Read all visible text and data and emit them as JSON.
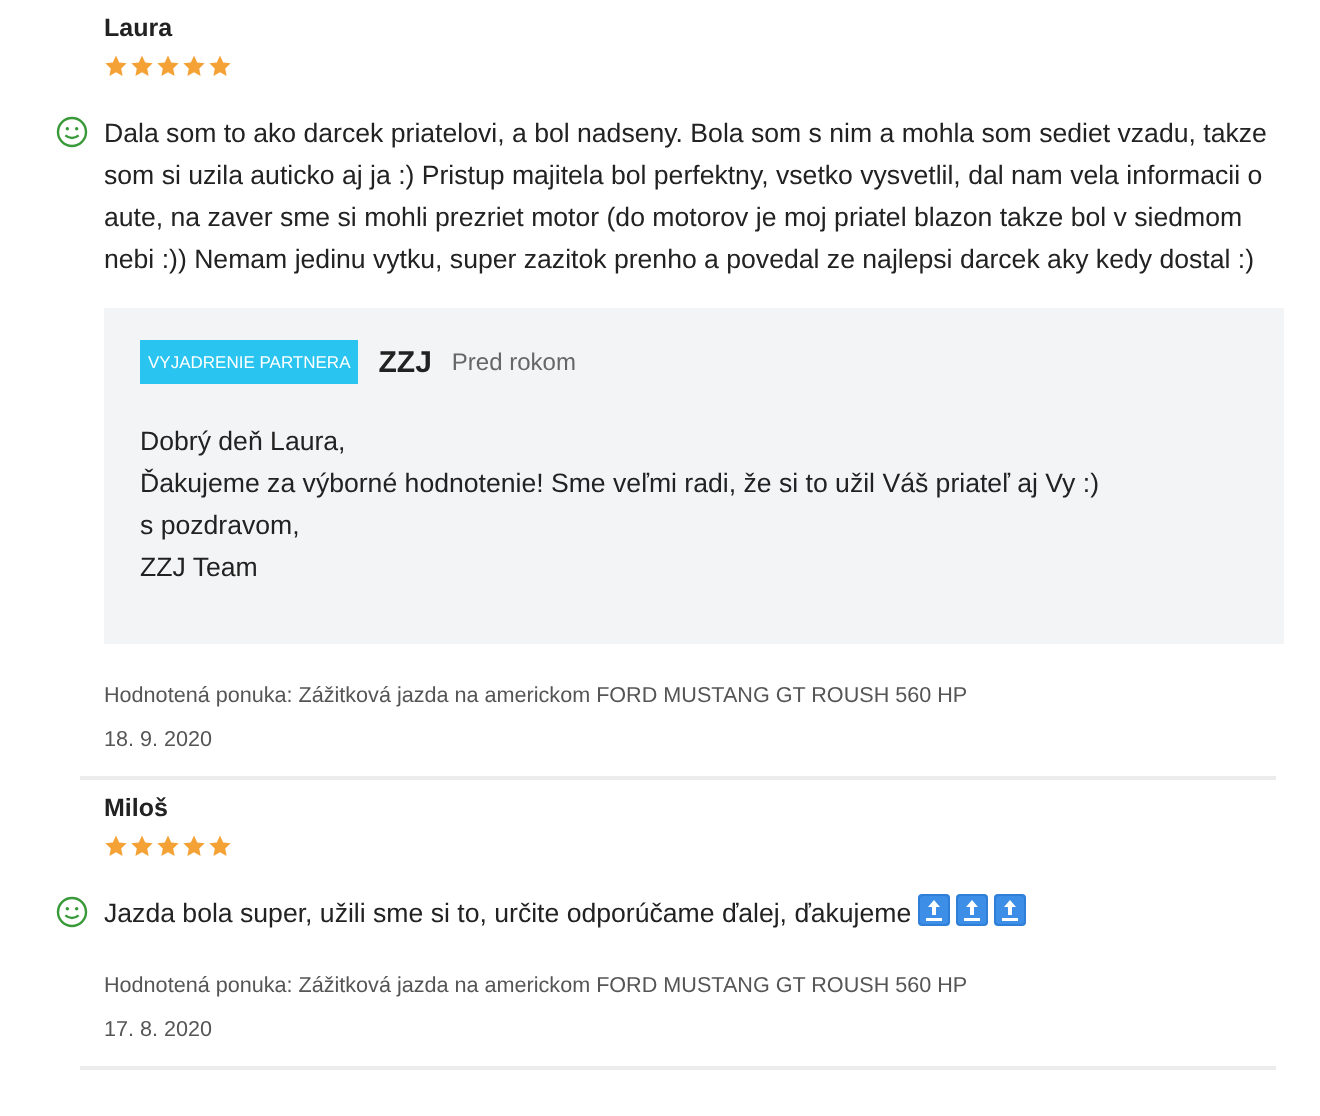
{
  "reviews": [
    {
      "author": "Laura",
      "stars": 5,
      "kind": "positive",
      "text": "Dala som to ako darcek priatelovi, a bol nadseny. Bola som s nim a mohla som sediet vzadu, takze som si uzila auticko aj ja :) Pristup majitela bol perfektny, vsetko vysvetlil, dal nam vela informacii o aute, na zaver sme si mohli prezriet motor (do motorov je moj priatel blazon takze bol v siedmom nebi :)) Nemam jedinu vytku, super zazitok prenho a povedal ze najlepsi darcek aky kedy dostal :)",
      "reply": {
        "badge": "VYJADRENIE PARTNERA",
        "partner": "ZZJ",
        "time": "Pred rokom",
        "lines": [
          "Dobrý deň Laura,",
          "Ďakujeme za výborné hodnotenie! Sme veľmi radi, že si to užil Váš priateľ aj Vy :)",
          "s pozdravom,",
          "ZZJ Team"
        ]
      },
      "offer": "Hodnotená ponuka: Zážitková jazda na americkom FORD MUSTANG GT ROUSH 560 HP",
      "date": "18. 9. 2020"
    },
    {
      "author": "Miloš",
      "stars": 5,
      "kind": "positive",
      "text": "Jazda bola super, užili sme si to, určite odporúčame ďalej, ďakujeme",
      "trailing_icons": [
        {
          "kind": "top"
        },
        {
          "kind": "top"
        },
        {
          "kind": "top"
        }
      ],
      "offer": "Hodnotená ponuka: Zážitková jazda na americkom FORD MUSTANG GT ROUSH 560 HP",
      "date": "17. 8. 2020"
    }
  ]
}
